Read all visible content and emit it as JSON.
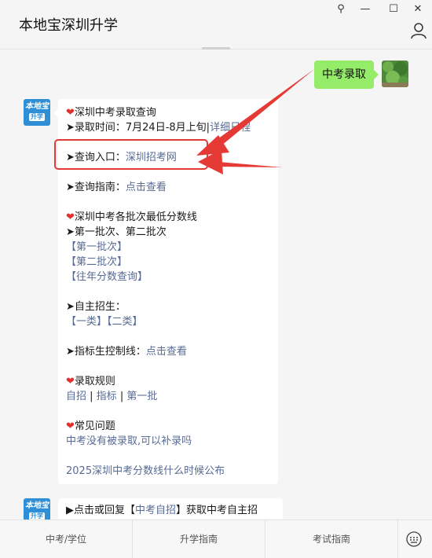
{
  "window": {
    "title": "本地宝深圳升学",
    "controls": {
      "pin": "⚲",
      "minimize": "—",
      "maximize": "☐",
      "close": "✕"
    }
  },
  "user_bubble": {
    "text": "中考录取"
  },
  "bot_avatar": {
    "line1": "本地宝",
    "line2": "升学"
  },
  "message": {
    "s1_title": "深圳中考录取查询",
    "s1_time_prefix": "➤录取时间：7月24日-8月上旬|",
    "s1_time_link": "详细日程",
    "s1_entry_prefix": "➤查询入口：",
    "s1_entry_link": "深圳招考网",
    "s1_guide_prefix": "➤查询指南：",
    "s1_guide_link": "点击查看",
    "s2_title": "深圳中考各批次最低分数线",
    "s2_batches": "➤第一批次、第二批次",
    "s2_link1": "【第一批次】",
    "s2_link2": "【第二批次】",
    "s2_link3": "【往年分数查询】",
    "s3_title": "➤自主招生：",
    "s3_link1": "【一类】",
    "s3_link2": "【二类】",
    "s4_prefix": "➤指标生控制线：",
    "s4_link": "点击查看",
    "s5_title": "录取规则",
    "s5_link1": "自招",
    "s5_link2": "指标",
    "s5_link3": "第一批",
    "s5_sep": " | ",
    "s6_title": "常见问题",
    "s6_link1": "中考没有被录取,可以补录吗",
    "s6_link2": "2025深圳中考分数线什么时候公布"
  },
  "message2": {
    "prefix": "▶点击或回复【",
    "link": "中考自招",
    "suffix": "】获取中考自主招"
  },
  "bottom_tabs": [
    "中考/学位",
    "升学指南",
    "考试指南"
  ],
  "colors": {
    "link": "#576b95",
    "bubble_green": "#95ec69",
    "highlight_red": "#e53935",
    "heart": "#e0312f"
  },
  "icons": {
    "heart": "❤",
    "user": "user-icon",
    "keyboard": "keyboard-icon"
  }
}
